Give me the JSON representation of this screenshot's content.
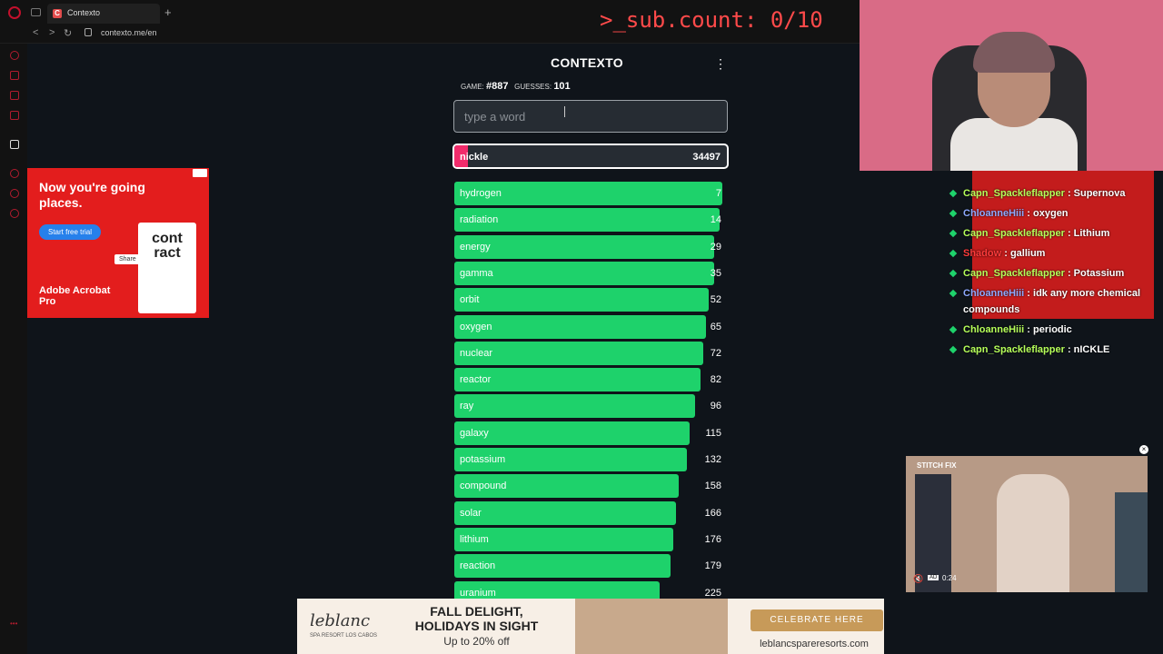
{
  "browser": {
    "tab_title": "Contexto",
    "tab_favicon": "C",
    "url": "contexto.me/en",
    "new_tab": "+",
    "back": "<",
    "forward": ">",
    "reload": "↻"
  },
  "overlay": {
    "sub_count": ">_sub.count: 0/10"
  },
  "game": {
    "title": "CONTEXTO",
    "game_label": "GAME:",
    "game_number": "#887",
    "guesses_label": "GUESSES:",
    "guesses_count": "101",
    "input_placeholder": "type a word",
    "menu": "⋮",
    "current": {
      "word": "nickle",
      "rank": "34497",
      "fill": 0.05
    },
    "guesses": [
      {
        "word": "hydrogen",
        "rank": "7",
        "fill": 0.99
      },
      {
        "word": "radiation",
        "rank": "14",
        "fill": 0.98
      },
      {
        "word": "energy",
        "rank": "29",
        "fill": 0.96
      },
      {
        "word": "gamma",
        "rank": "35",
        "fill": 0.96
      },
      {
        "word": "orbit",
        "rank": "52",
        "fill": 0.94
      },
      {
        "word": "oxygen",
        "rank": "65",
        "fill": 0.93
      },
      {
        "word": "nuclear",
        "rank": "72",
        "fill": 0.92
      },
      {
        "word": "reactor",
        "rank": "82",
        "fill": 0.91
      },
      {
        "word": "ray",
        "rank": "96",
        "fill": 0.89
      },
      {
        "word": "galaxy",
        "rank": "115",
        "fill": 0.87
      },
      {
        "word": "potassium",
        "rank": "132",
        "fill": 0.86
      },
      {
        "word": "compound",
        "rank": "158",
        "fill": 0.83
      },
      {
        "word": "solar",
        "rank": "166",
        "fill": 0.82
      },
      {
        "word": "lithium",
        "rank": "176",
        "fill": 0.81
      },
      {
        "word": "reaction",
        "rank": "179",
        "fill": 0.8
      },
      {
        "word": "uranium",
        "rank": "225",
        "fill": 0.76
      }
    ]
  },
  "ads": {
    "left": {
      "headline": "Now you're going places.",
      "cta": "Start free trial",
      "brand": "Adobe Acrobat Pro",
      "card_text": "cont ract",
      "share": "Share"
    },
    "bottom": {
      "logo": "leblanc",
      "logo_sub": "SPA RESORT LOS CABOS",
      "headline": "FALL DELIGHT, HOLIDAYS IN SIGHT",
      "offer": "Up to 20% off",
      "button": "CELEBRATE HERE",
      "site": "leblancspareresorts.com"
    },
    "video": {
      "label": "STITCH FIX",
      "ad_tag": "AD",
      "time": "0:24"
    }
  },
  "chat": [
    {
      "user": "Capn_Spackleflapper",
      "text": ": Supernova",
      "style": "u1"
    },
    {
      "user": "ChloanneHiii",
      "text": ": oxygen",
      "style": "u2"
    },
    {
      "user": "Capn_Spackleflapper",
      "text": ": Lithium",
      "style": "u1"
    },
    {
      "user": "Shadow",
      "text": ": gallium",
      "style": "u3"
    },
    {
      "user": "Capn_Spackleflapper",
      "text": ": Potassium",
      "style": "u1"
    },
    {
      "user": "ChloanneHiii",
      "text": ": idk any more chemical compounds",
      "style": "u2"
    },
    {
      "user": "ChloanneHiii",
      "text": ": periodic",
      "style": "u1"
    },
    {
      "user": "Capn_Spackleflapper",
      "text": ": nICKLE",
      "style": "u1"
    }
  ]
}
